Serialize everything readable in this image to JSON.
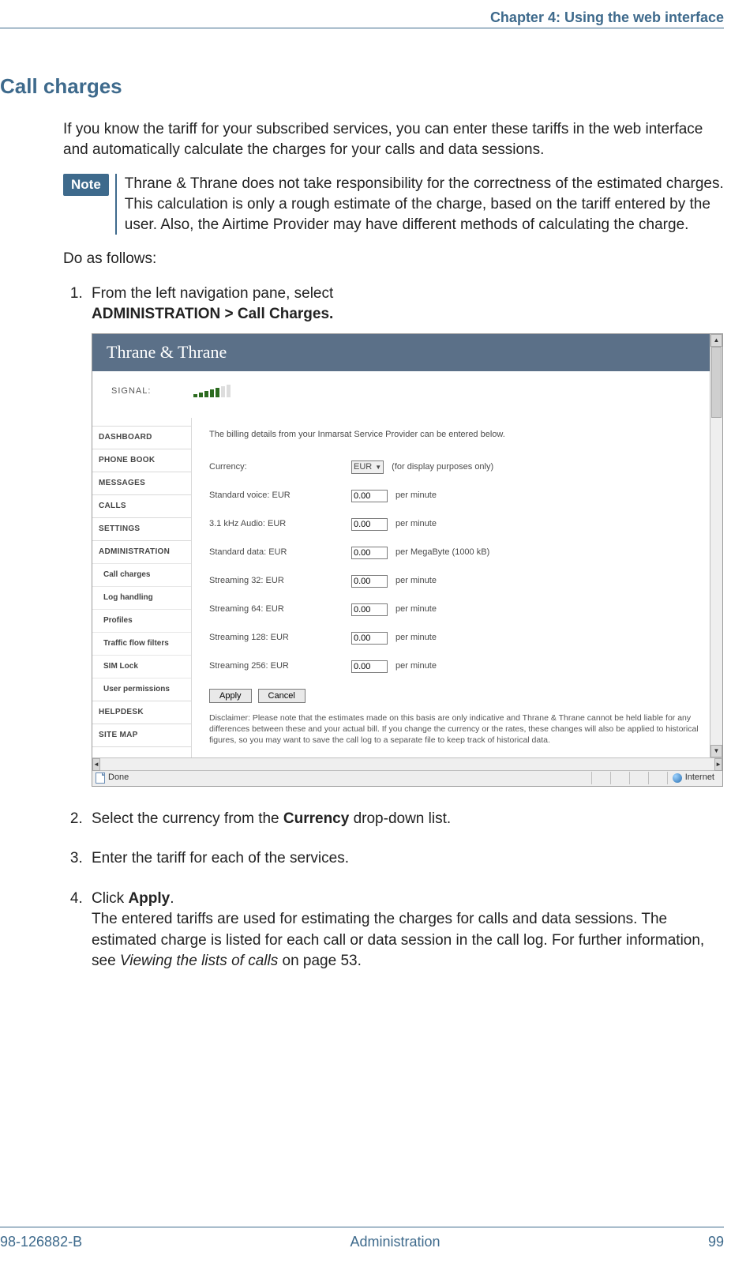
{
  "header": {
    "chapter": "Chapter 4: Using the web interface"
  },
  "section": {
    "title": "Call charges",
    "intro": "If you know the tariff for your subscribed services, you can enter these tariffs in the web interface and automatically calculate the charges for your calls and data sessions.",
    "note_label": "Note",
    "note_text": "Thrane & Thrane does not take responsibility for the correctness of the estimated charges. This calculation is only a rough estimate of the charge, based on the tariff entered by the user. Also, the Airtime Provider may have different methods of calculating the charge.",
    "lead_in": "Do as follows:",
    "step1_a": "From the left navigation pane, select",
    "step1_b": "ADMINISTRATION > Call Charges.",
    "step2_pre": "Select the currency from the ",
    "step2_bold": "Currency",
    "step2_post": " drop-down list.",
    "step3": "Enter the tariff for each of the services.",
    "step4_pre": "Click ",
    "step4_bold": "Apply",
    "step4_post": ".",
    "step4_body_a": "The entered tariffs are used for estimating the charges for calls and data sessions. The estimated charge is listed for each call or data session in the call log. For further information, see ",
    "step4_body_i": "Viewing the lists of calls",
    "step4_body_b": " on page 53."
  },
  "app": {
    "brand": "Thrane & Thrane",
    "signal_label": "SIGNAL:",
    "nav": {
      "dashboard": "DASHBOARD",
      "phonebook": "PHONE BOOK",
      "messages": "MESSAGES",
      "calls": "CALLS",
      "settings": "SETTINGS",
      "administration": "ADMINISTRATION",
      "call_charges": "Call charges",
      "log_handling": "Log handling",
      "profiles": "Profiles",
      "traffic_flow": "Traffic flow filters",
      "sim_lock": "SIM Lock",
      "user_perm": "User permissions",
      "helpdesk": "HELPDESK",
      "sitemap": "SITE MAP"
    },
    "content": {
      "intro": "The billing details from your Inmarsat Service Provider can be entered below.",
      "currency_label": "Currency:",
      "currency_value": "EUR",
      "currency_hint": "(for display purposes only)",
      "rows": [
        {
          "label": "Standard voice: EUR",
          "value": "0.00",
          "unit": "per minute"
        },
        {
          "label": "3.1 kHz Audio: EUR",
          "value": "0.00",
          "unit": "per minute"
        },
        {
          "label": "Standard data: EUR",
          "value": "0.00",
          "unit": "per MegaByte (1000 kB)"
        },
        {
          "label": "Streaming 32: EUR",
          "value": "0.00",
          "unit": "per minute"
        },
        {
          "label": "Streaming 64: EUR",
          "value": "0.00",
          "unit": "per minute"
        },
        {
          "label": "Streaming 128: EUR",
          "value": "0.00",
          "unit": "per minute"
        },
        {
          "label": "Streaming 256: EUR",
          "value": "0.00",
          "unit": "per minute"
        }
      ],
      "apply": "Apply",
      "cancel": "Cancel",
      "disclaimer": "Disclaimer: Please note that the estimates made on this basis are only indicative and Thrane & Thrane cannot be held liable for any differences between these and your actual bill. If you change the currency or the rates, these changes will also be applied to historical figures, so you may want to save the call log to a separate file to keep track of historical data."
    },
    "status": {
      "done": "Done",
      "zone": "Internet"
    }
  },
  "footer": {
    "doc": "98-126882-B",
    "section": "Administration",
    "page": "99"
  }
}
